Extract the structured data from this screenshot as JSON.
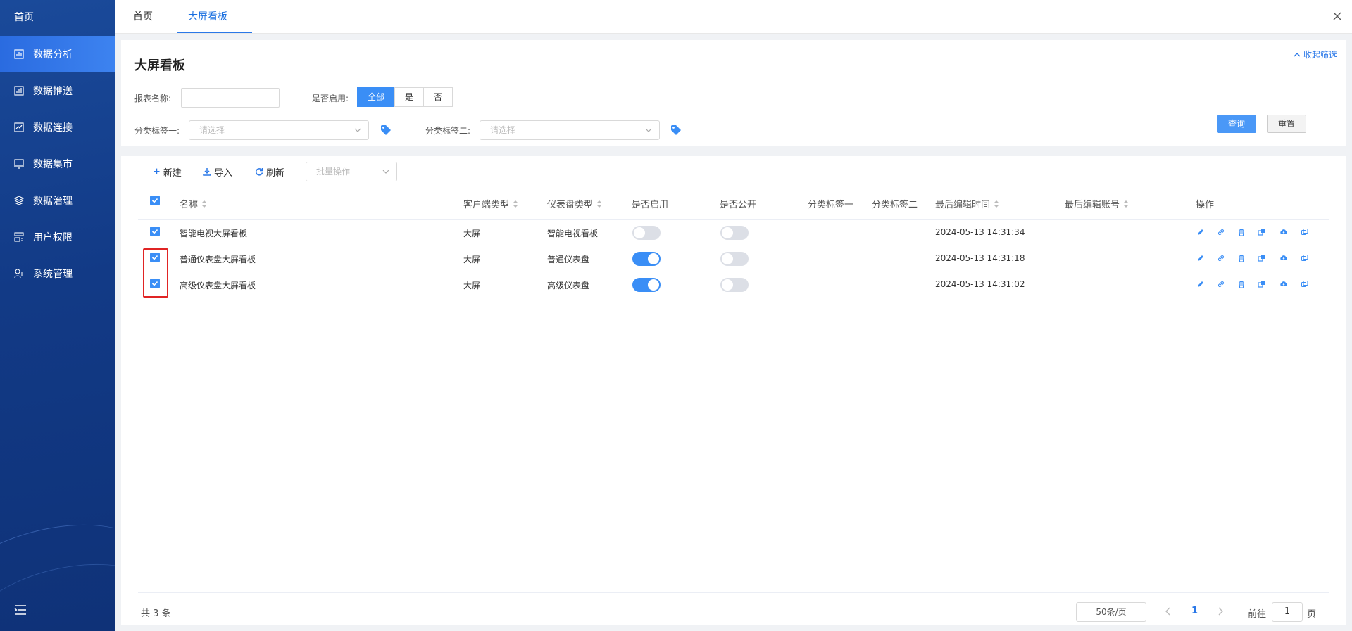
{
  "sidebar": {
    "home": "首页",
    "items": [
      {
        "label": "数据分析",
        "icon": "chart-icon",
        "active": true
      },
      {
        "label": "数据推送",
        "icon": "push-icon"
      },
      {
        "label": "数据连接",
        "icon": "connect-icon"
      },
      {
        "label": "数据集市",
        "icon": "market-icon"
      },
      {
        "label": "数据治理",
        "icon": "layers-icon"
      },
      {
        "label": "用户权限",
        "icon": "users-icon"
      },
      {
        "label": "系统管理",
        "icon": "system-icon"
      }
    ]
  },
  "tabs": [
    {
      "label": "首页"
    },
    {
      "label": "大屏看板",
      "active": true
    }
  ],
  "filter": {
    "title": "大屏看板",
    "collapse_label": "收起筛选",
    "report_name_label": "报表名称:",
    "enabled_label": "是否启用:",
    "enabled_options": [
      "全部",
      "是",
      "否"
    ],
    "tag1_label": "分类标签一:",
    "tag2_label": "分类标签二:",
    "select_placeholder": "请选择",
    "query": "查询",
    "reset": "重置"
  },
  "toolbar": {
    "new": "新建",
    "import": "导入",
    "refresh": "刷新",
    "batch": "批量操作"
  },
  "table": {
    "headers": {
      "name": "名称",
      "client_type": "客户端类型",
      "dashboard_type": "仪表盘类型",
      "enabled": "是否启用",
      "public": "是否公开",
      "tag1": "分类标签一",
      "tag2": "分类标签二",
      "edit_time": "最后编辑时间",
      "edit_account": "最后编辑账号",
      "ops": "操作"
    },
    "rows": [
      {
        "name": "智能电视大屏看板",
        "client_type": "大屏",
        "dashboard_type": "智能电视看板",
        "enabled": false,
        "public": false,
        "edit_time": "2024-05-13 14:31:34"
      },
      {
        "name": "普通仪表盘大屏看板",
        "client_type": "大屏",
        "dashboard_type": "普通仪表盘",
        "enabled": true,
        "public": false,
        "edit_time": "2024-05-13 14:31:18"
      },
      {
        "name": "高级仪表盘大屏看板",
        "client_type": "大屏",
        "dashboard_type": "高级仪表盘",
        "enabled": true,
        "public": false,
        "edit_time": "2024-05-13 14:31:02"
      }
    ]
  },
  "pagination": {
    "total": "共 3 条",
    "page_size": "50条/页",
    "current": "1",
    "goto_label": "前往",
    "goto_value": "1",
    "page_suffix": "页"
  },
  "colors": {
    "accent": "#3a8ef6",
    "sidebar": "#123a86",
    "highlight": "#e02424"
  }
}
